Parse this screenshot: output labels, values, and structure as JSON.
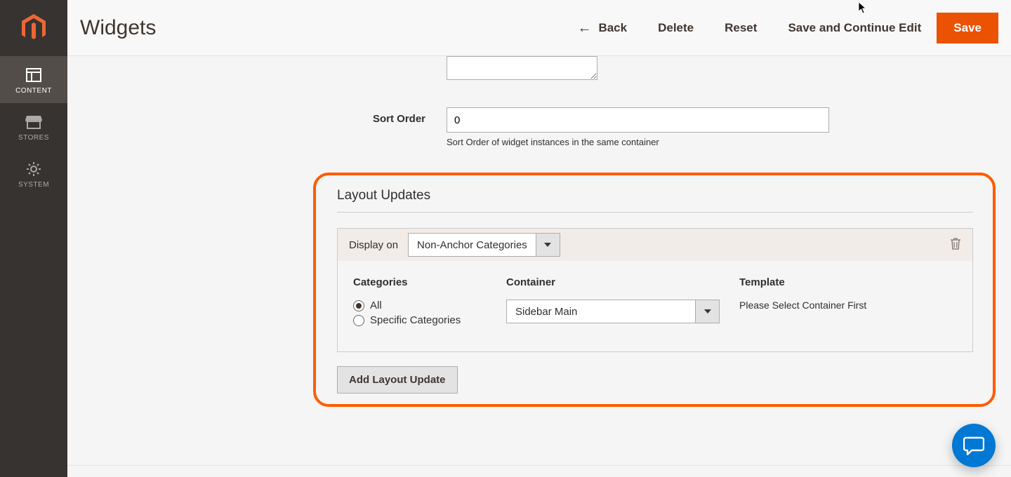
{
  "header": {
    "title": "Widgets",
    "back": "Back",
    "delete": "Delete",
    "reset": "Reset",
    "save_continue": "Save and Continue Edit",
    "save": "Save"
  },
  "sidebar": {
    "items": [
      {
        "key": "content",
        "label": "CONTENT",
        "icon": "layout-icon",
        "active": true
      },
      {
        "key": "stores",
        "label": "STORES",
        "icon": "storefront-icon",
        "active": false
      },
      {
        "key": "system",
        "label": "SYSTEM",
        "icon": "gear-icon",
        "active": false
      }
    ]
  },
  "form": {
    "sort_order": {
      "label": "Sort Order",
      "value": "0",
      "help": "Sort Order of widget instances in the same container"
    }
  },
  "layout": {
    "heading": "Layout Updates",
    "display_on_label": "Display on",
    "display_on_value": "Non-Anchor Categories",
    "columns": {
      "categories": "Categories",
      "container": "Container",
      "template": "Template"
    },
    "categories_options": {
      "all": "All",
      "specific": "Specific Categories",
      "selected": "all"
    },
    "container_value": "Sidebar Main",
    "template_placeholder": "Please Select Container First",
    "add_button": "Add Layout Update"
  }
}
